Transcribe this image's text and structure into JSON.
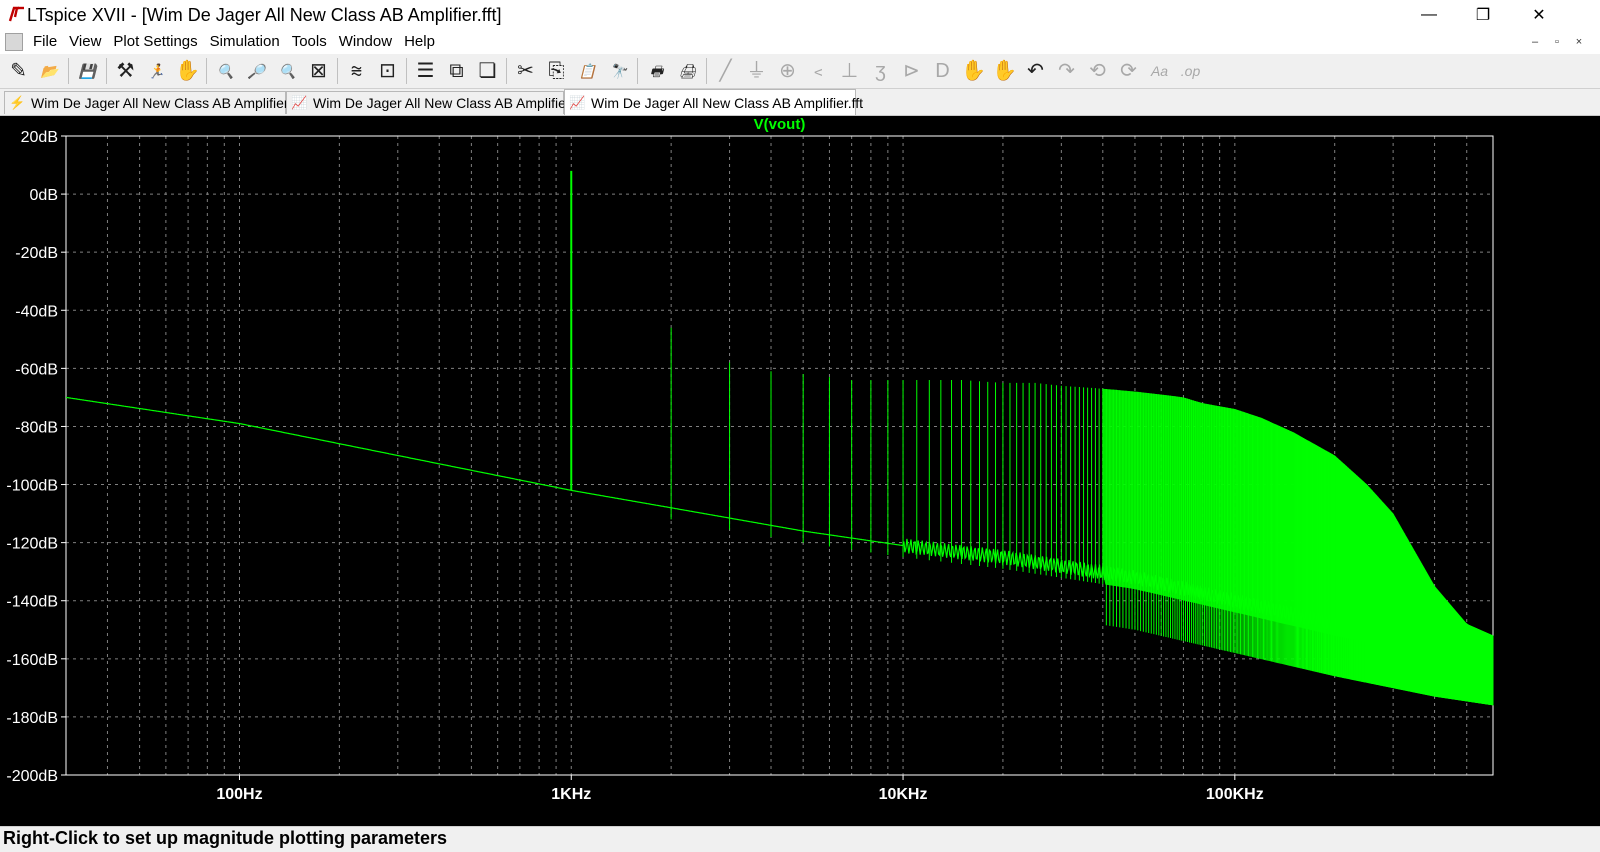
{
  "window": {
    "title": "LTspice XVII - [Wim De Jager All New Class AB Amplifier.fft]",
    "controls": {
      "minimize": "—",
      "maximize": "❐",
      "close": "✕"
    }
  },
  "menu": {
    "items": [
      "File",
      "View",
      "Plot Settings",
      "Simulation",
      "Tools",
      "Window",
      "Help"
    ],
    "mdi_controls": [
      "–",
      "▫",
      "×"
    ]
  },
  "toolbar": {
    "buttons": [
      {
        "icon": "new-schematic-icon",
        "glyph": "✎",
        "enabled": true
      },
      {
        "icon": "open-icon",
        "glyph": "📂",
        "enabled": true
      },
      {
        "sep": true
      },
      {
        "icon": "save-icon",
        "glyph": "💾",
        "enabled": true
      },
      {
        "sep": true
      },
      {
        "icon": "control-panel-icon",
        "glyph": "⚒",
        "enabled": true
      },
      {
        "icon": "run-icon",
        "glyph": "🏃",
        "enabled": false
      },
      {
        "icon": "halt-icon",
        "glyph": "✋",
        "enabled": false
      },
      {
        "sep": true
      },
      {
        "icon": "zoom-in-icon",
        "glyph": "🔍",
        "enabled": true
      },
      {
        "icon": "zoom-pan-icon",
        "glyph": "🔎",
        "enabled": true
      },
      {
        "icon": "zoom-out-icon",
        "glyph": "🔍",
        "enabled": true
      },
      {
        "icon": "zoom-fit-icon",
        "glyph": "⊠",
        "enabled": true
      },
      {
        "sep": true
      },
      {
        "icon": "autorange-icon",
        "glyph": "⩬",
        "enabled": true
      },
      {
        "icon": "plot-settings-icon",
        "glyph": "⊡",
        "enabled": true
      },
      {
        "sep": true
      },
      {
        "icon": "tile-horizontal-icon",
        "glyph": "☰",
        "enabled": true
      },
      {
        "icon": "tile-vertical-icon",
        "glyph": "⧉",
        "enabled": true
      },
      {
        "icon": "cascade-icon",
        "glyph": "❏",
        "enabled": true
      },
      {
        "sep": true
      },
      {
        "icon": "cut-icon",
        "glyph": "✂",
        "enabled": true
      },
      {
        "icon": "copy-icon",
        "glyph": "⎘",
        "enabled": true
      },
      {
        "icon": "paste-icon",
        "glyph": "📋",
        "enabled": true
      },
      {
        "icon": "find-icon",
        "glyph": "🔭",
        "enabled": true
      },
      {
        "sep": true
      },
      {
        "icon": "print-icon",
        "glyph": "🖶",
        "enabled": true
      },
      {
        "icon": "print-setup-icon",
        "glyph": "🖨",
        "enabled": true
      },
      {
        "sep": true
      },
      {
        "icon": "draw-wire-icon",
        "glyph": "╱",
        "enabled": false
      },
      {
        "icon": "ground-icon",
        "glyph": "⏚",
        "enabled": false
      },
      {
        "icon": "label-net-icon",
        "glyph": "⊕",
        "enabled": false
      },
      {
        "icon": "resistor-icon",
        "glyph": "﹤",
        "enabled": false
      },
      {
        "icon": "capacitor-icon",
        "glyph": "⊥",
        "enabled": false
      },
      {
        "icon": "inductor-icon",
        "glyph": "ʒ",
        "enabled": false
      },
      {
        "icon": "diode-icon",
        "glyph": "⊳",
        "enabled": false
      },
      {
        "icon": "component-icon",
        "glyph": "D",
        "enabled": false
      },
      {
        "icon": "move-icon",
        "glyph": "✋",
        "enabled": false
      },
      {
        "icon": "drag-icon",
        "glyph": "✋",
        "enabled": false
      },
      {
        "icon": "undo-icon",
        "glyph": "↶",
        "enabled": true
      },
      {
        "icon": "redo-icon",
        "glyph": "↷",
        "enabled": false
      },
      {
        "icon": "rotate-icon",
        "glyph": "⟲",
        "enabled": false
      },
      {
        "icon": "mirror-icon",
        "glyph": "⟳",
        "enabled": false
      },
      {
        "icon": "text-icon",
        "glyph": "Aa",
        "enabled": false
      },
      {
        "icon": "spice-directive-icon",
        "glyph": ".op",
        "enabled": false
      }
    ]
  },
  "tabs": [
    {
      "label": "Wim De Jager All New Class AB Amplifier",
      "icon": "schematic-tab-icon",
      "glyph": "⚡",
      "active": false
    },
    {
      "label": "Wim De Jager All New Class AB Amplifier",
      "icon": "waveform-tab-icon",
      "glyph": "📈",
      "active": false
    },
    {
      "label": "Wim De Jager All New Class AB Amplifier.fft",
      "icon": "fft-tab-icon",
      "glyph": "📈",
      "active": true
    }
  ],
  "plot": {
    "trace_color": "#00ff00",
    "grid_color": "#808080",
    "axis_color": "#ffffff",
    "label_color": "#ffffff",
    "background": "#000000"
  },
  "chart_data": {
    "type": "line",
    "title": "V(vout)",
    "xlabel": "",
    "ylabel": "",
    "xscale": "log",
    "xlim": [
      30,
      600000
    ],
    "ylim": [
      -200,
      20
    ],
    "y_ticks": [
      "20dB",
      "0dB",
      "-20dB",
      "-40dB",
      "-60dB",
      "-80dB",
      "-100dB",
      "-120dB",
      "-140dB",
      "-160dB",
      "-180dB",
      "-200dB"
    ],
    "y_tick_values": [
      20,
      0,
      -20,
      -40,
      -60,
      -80,
      -100,
      -120,
      -140,
      -160,
      -180,
      -200
    ],
    "x_ticks": [
      "100Hz",
      "1KHz",
      "10KHz",
      "100KHz"
    ],
    "x_tick_values": [
      100,
      1000,
      10000,
      100000
    ],
    "grid": true,
    "series": [
      {
        "name": "V(vout)",
        "fundamental": {
          "freq": 1000,
          "db": 8
        },
        "floor": [
          [
            30,
            -70
          ],
          [
            100,
            -79
          ],
          [
            300,
            -90
          ],
          [
            1000,
            -102
          ],
          [
            2000,
            -108
          ],
          [
            5000,
            -116
          ],
          [
            10000,
            -121
          ],
          [
            20000,
            -125
          ],
          [
            50000,
            -132
          ],
          [
            100000,
            -140
          ],
          [
            200000,
            -148
          ],
          [
            400000,
            -155
          ],
          [
            600000,
            -158
          ]
        ],
        "harmonics": [
          [
            2000,
            -46
          ],
          [
            3000,
            -58
          ],
          [
            4000,
            -61
          ],
          [
            5000,
            -62
          ],
          [
            6000,
            -63
          ],
          [
            7000,
            -64
          ],
          [
            8000,
            -64
          ],
          [
            9000,
            -64
          ],
          [
            10000,
            -64
          ],
          [
            12000,
            -64
          ],
          [
            15000,
            -64
          ],
          [
            20000,
            -65
          ],
          [
            25000,
            -65
          ],
          [
            30000,
            -66
          ],
          [
            40000,
            -67
          ],
          [
            50000,
            -68
          ],
          [
            60000,
            -69
          ],
          [
            70000,
            -70
          ],
          [
            80000,
            -72
          ],
          [
            100000,
            -74
          ],
          [
            120000,
            -77
          ],
          [
            150000,
            -82
          ],
          [
            200000,
            -90
          ],
          [
            250000,
            -100
          ],
          [
            300000,
            -110
          ],
          [
            400000,
            -135
          ],
          [
            500000,
            -148
          ],
          [
            600000,
            -152
          ]
        ]
      }
    ]
  },
  "status": {
    "text": "Right-Click to set up magnitude plotting parameters"
  }
}
